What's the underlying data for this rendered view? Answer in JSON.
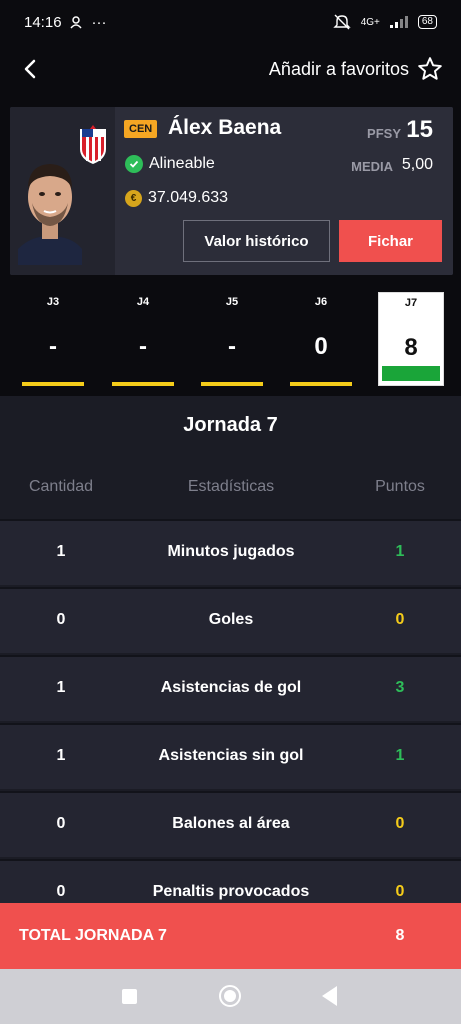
{
  "status": {
    "time": "14:16",
    "network": "4G+",
    "battery": "68"
  },
  "header": {
    "favorites_label": "Añadir a favoritos"
  },
  "player": {
    "position": "CEN",
    "name": "Álex Baena",
    "pfsy_label": "PFSY",
    "pfsy_value": "15",
    "status": "Alineable",
    "media_label": "MEDIA",
    "media_value": "5,00",
    "value": "37.049.633",
    "historic_button": "Valor histórico",
    "sign_button": "Fichar"
  },
  "jornadas": [
    {
      "label": "J3",
      "value": "-"
    },
    {
      "label": "J4",
      "value": "-"
    },
    {
      "label": "J5",
      "value": "-"
    },
    {
      "label": "J6",
      "value": "0"
    },
    {
      "label": "J7",
      "value": "8"
    }
  ],
  "stats": {
    "title": "Jornada 7",
    "columns": {
      "qty": "Cantidad",
      "stat": "Estadísticas",
      "points": "Puntos"
    },
    "rows": [
      {
        "qty": "1",
        "stat": "Minutos jugados",
        "points": "1",
        "color": "#2ebd59"
      },
      {
        "qty": "0",
        "stat": "Goles",
        "points": "0",
        "color": "#f5cc1a"
      },
      {
        "qty": "1",
        "stat": "Asistencias de gol",
        "points": "3",
        "color": "#2ebd59"
      },
      {
        "qty": "1",
        "stat": "Asistencias sin gol",
        "points": "1",
        "color": "#2ebd59"
      },
      {
        "qty": "0",
        "stat": "Balones al área",
        "points": "0",
        "color": "#f5cc1a"
      },
      {
        "qty": "0",
        "stat": "Penaltis provocados",
        "points": "0",
        "color": "#f5cc1a"
      }
    ]
  },
  "total": {
    "label": "TOTAL JORNADA 7",
    "value": "8"
  },
  "colors": {
    "accent": "#f0504e",
    "positive": "#2ebd59",
    "neutral": "#f5cc1a",
    "badge": "#f5a623"
  }
}
